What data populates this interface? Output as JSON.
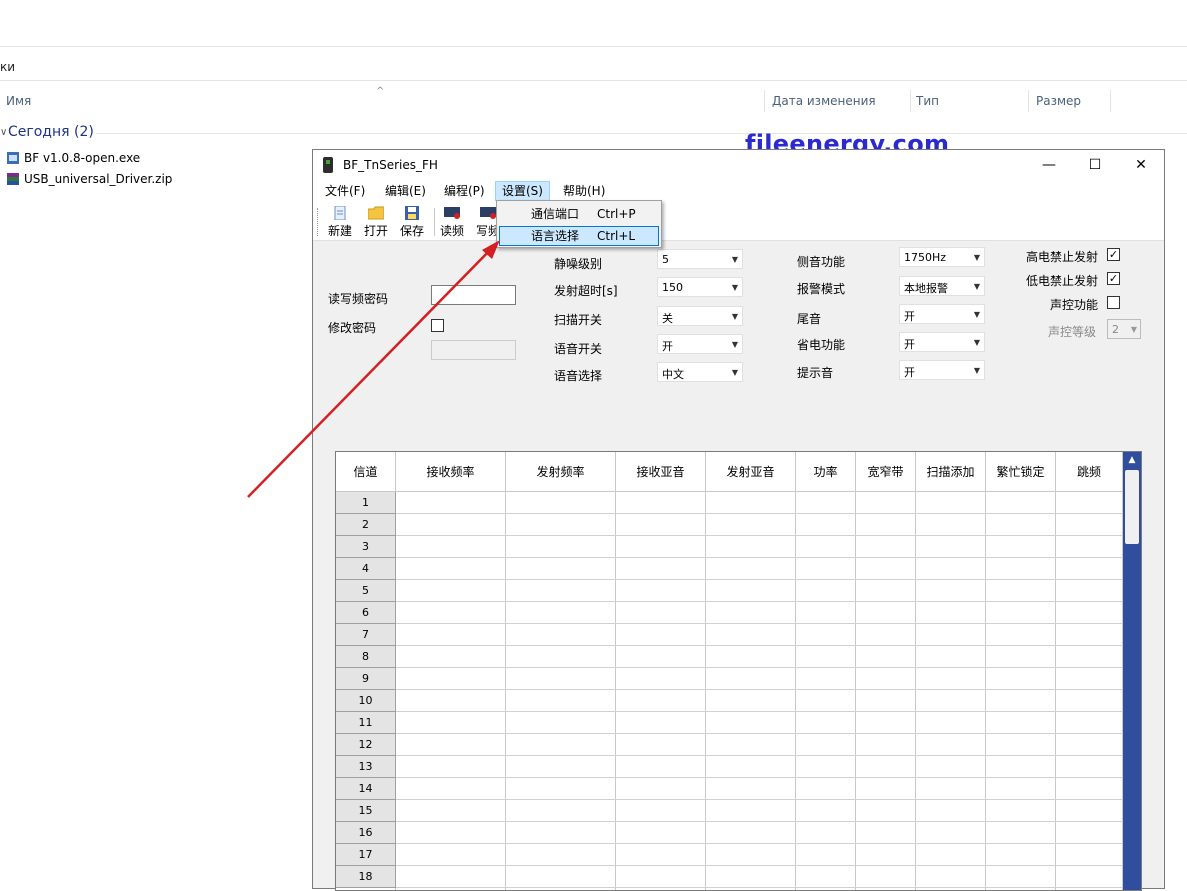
{
  "explorer": {
    "breadcrumb_fragment": "ки",
    "columns": {
      "name": "Имя",
      "date": "Дата изменения",
      "type": "Тип",
      "size": "Размер"
    },
    "group_title": "Сегодня (2)",
    "files": [
      {
        "name": "BF v1.0.8-open.exe"
      },
      {
        "name": "USB_universal_Driver.zip"
      }
    ]
  },
  "watermark": "fileenergy.com",
  "window": {
    "title": "BF_TnSeries_FH",
    "controls": {
      "minimize": "—",
      "maximize": "☐",
      "close": "✕"
    },
    "menu": [
      {
        "label": "文件(F)"
      },
      {
        "label": "编辑(E)"
      },
      {
        "label": "编程(P)"
      },
      {
        "label": "设置(S)"
      },
      {
        "label": "帮助(H)"
      }
    ],
    "dropdown": [
      {
        "label": "通信端口",
        "shortcut": "Ctrl+P"
      },
      {
        "label": "语言选择",
        "shortcut": "Ctrl+L"
      }
    ],
    "toolbar": [
      {
        "label": "新建"
      },
      {
        "label": "打开"
      },
      {
        "label": "保存"
      },
      {
        "label": "读频"
      },
      {
        "label": "写频"
      }
    ],
    "password": {
      "read_write_label": "读写频密码",
      "read_write_value": "",
      "change_label": "修改密码",
      "change_value": ""
    },
    "settings_col1": [
      {
        "label": "静噪级别",
        "value": "5"
      },
      {
        "label": "发射超时[s]",
        "value": "150"
      },
      {
        "label": "扫描开关",
        "value": "关"
      },
      {
        "label": "语音开关",
        "value": "开"
      },
      {
        "label": "语音选择",
        "value": "中文"
      }
    ],
    "settings_col2": [
      {
        "label": "侧音功能",
        "value": "1750Hz"
      },
      {
        "label": "报警模式",
        "value": "本地报警"
      },
      {
        "label": "尾音",
        "value": "开"
      },
      {
        "label": "省电功能",
        "value": "开"
      },
      {
        "label": "提示音",
        "value": "开"
      }
    ],
    "checks": [
      {
        "label": "高电禁止发射",
        "checked": "✓"
      },
      {
        "label": "低电禁止发射",
        "checked": "✓"
      },
      {
        "label": "声控功能",
        "checked": ""
      }
    ],
    "vox_level": {
      "label": "声控等级",
      "value": "2"
    },
    "grid": {
      "headers": [
        "信道",
        "接收频率",
        "发射频率",
        "接收亚音",
        "发射亚音",
        "功率",
        "宽窄带",
        "扫描添加",
        "繁忙锁定",
        "跳频"
      ],
      "rows": [
        "1",
        "2",
        "3",
        "4",
        "5",
        "6",
        "7",
        "8",
        "9",
        "10",
        "11",
        "12",
        "13",
        "14",
        "15",
        "16",
        "17",
        "18"
      ]
    }
  },
  "colors": {
    "annotation_arrow": "#d42020",
    "scrollbar": "#2f4f9e",
    "watermark": "#2a2ad0"
  }
}
